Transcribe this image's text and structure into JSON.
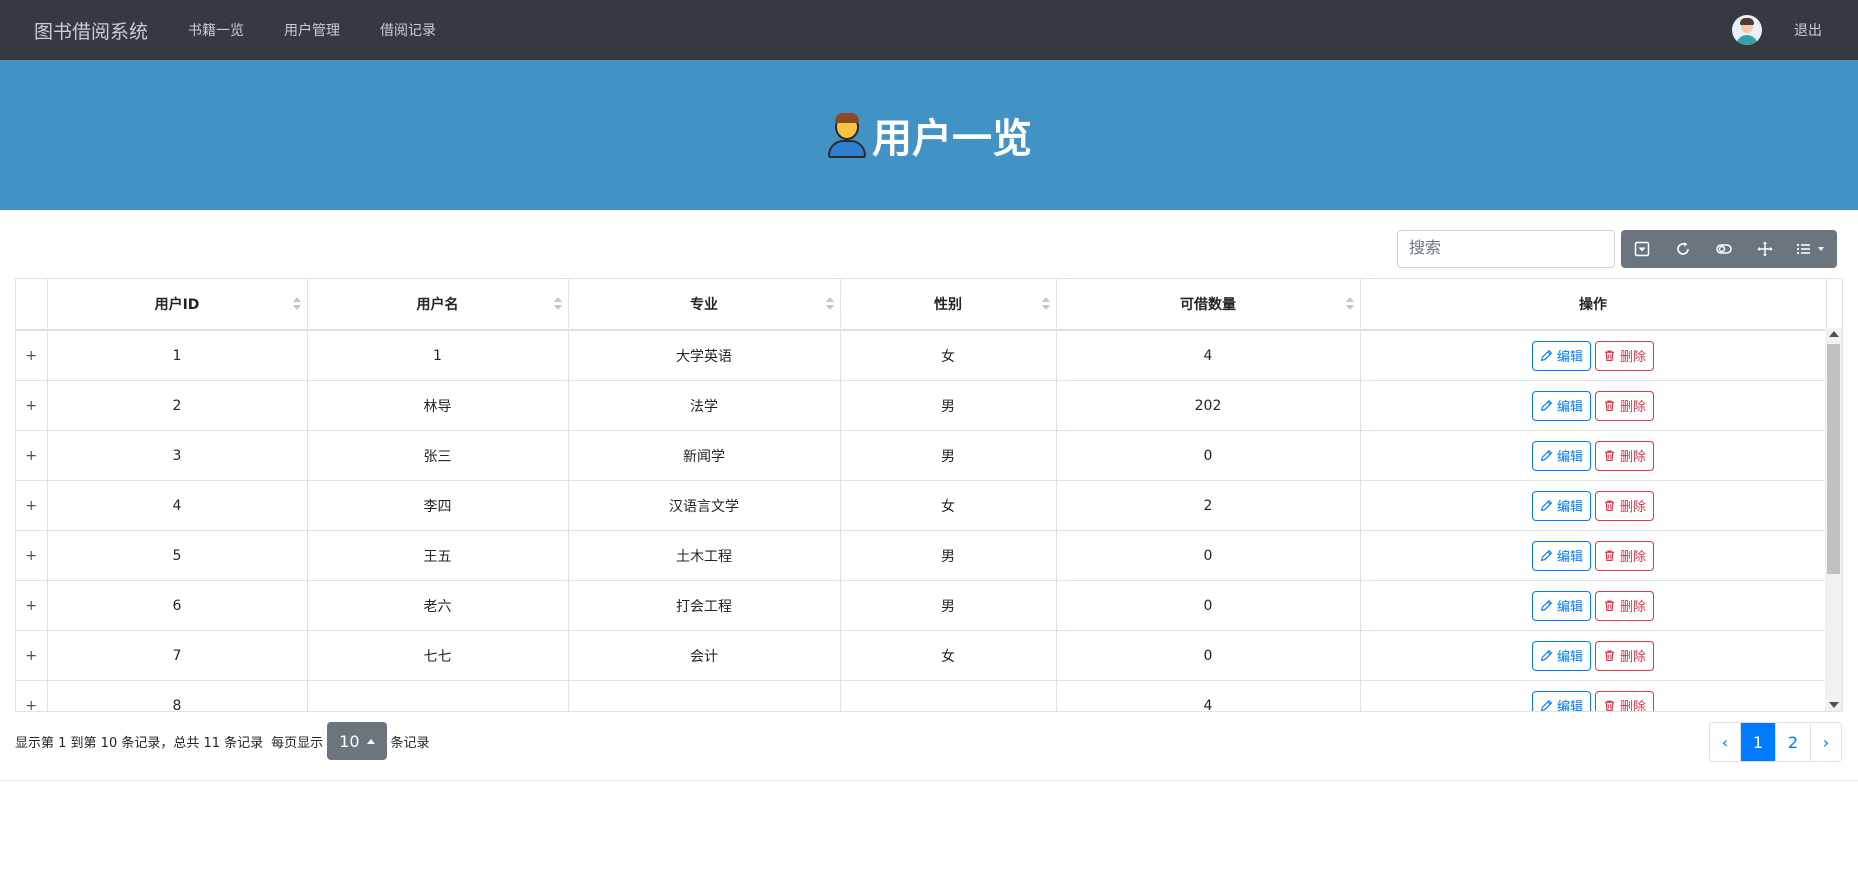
{
  "navbar": {
    "brand": "图书借阅系统",
    "links": [
      "书籍一览",
      "用户管理",
      "借阅记录"
    ],
    "logout": "退出"
  },
  "hero": {
    "title": "用户一览"
  },
  "toolbar": {
    "search_placeholder": "搜索"
  },
  "table": {
    "columns": [
      "用户ID",
      "用户名",
      "专业",
      "性别",
      "可借数量",
      "操作"
    ],
    "expand_symbol": "+",
    "edit_label": "编辑",
    "delete_label": "删除",
    "rows": [
      {
        "id": "1",
        "name": "1",
        "major": "大学英语",
        "gender": "女",
        "quota": "4"
      },
      {
        "id": "2",
        "name": "林导",
        "major": "法学",
        "gender": "男",
        "quota": "202"
      },
      {
        "id": "3",
        "name": "张三",
        "major": "新闻学",
        "gender": "男",
        "quota": "0"
      },
      {
        "id": "4",
        "name": "李四",
        "major": "汉语言文学",
        "gender": "女",
        "quota": "2"
      },
      {
        "id": "5",
        "name": "王五",
        "major": "土木工程",
        "gender": "男",
        "quota": "0"
      },
      {
        "id": "6",
        "name": "老六",
        "major": "打会工程",
        "gender": "男",
        "quota": "0"
      },
      {
        "id": "7",
        "name": "七七",
        "major": "会计",
        "gender": "女",
        "quota": "0"
      },
      {
        "id": "8",
        "name": "",
        "major": "",
        "gender": "",
        "quota": "4"
      }
    ]
  },
  "pagination": {
    "info_prefix": "显示第 1 到第 10 条记录，总共 11 条记录",
    "per_page_prefix": "每页显示",
    "page_size": "10",
    "per_page_suffix": "条记录",
    "prev": "‹",
    "pages": [
      "1",
      "2"
    ],
    "next": "›"
  }
}
